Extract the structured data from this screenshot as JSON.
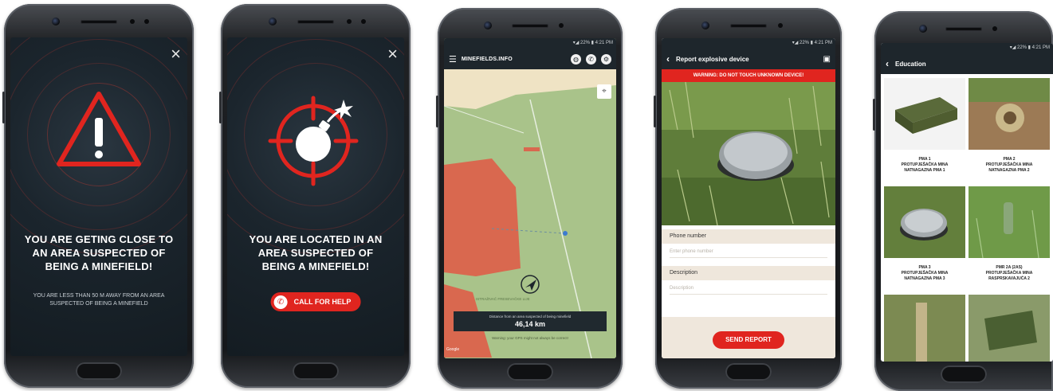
{
  "screens": {
    "approaching": {
      "close_icon": "×",
      "title_lines": [
        "YOU ARE GETING CLOSE TO",
        "AN AREA SUSPECTED OF",
        "BEING A MINEFIELD!"
      ],
      "sub_lines": [
        "YOU ARE LESS THAN 50 M AWAY FROM AN AREA",
        "SUSPECTED OF BEING A MINEFIELD"
      ]
    },
    "inside": {
      "close_icon": "×",
      "title_lines": [
        "YOU ARE LOCATED IN AN",
        "AREA SUSPECTED OF",
        "BEING A MINEFIELD!"
      ],
      "button_icon": "phone-icon",
      "button_label": "CALL FOR HELP"
    },
    "map": {
      "status": "▾◢ 22% ▮ 4:21 PM",
      "app_title": "MINEFIELDS.INFO",
      "place_label": "ISTRAŽIVAČ FRESEVAČKE LIJE",
      "distance_label": "Distance from an area suspected of being minefield",
      "distance_value": "46,14 km",
      "footer_note": "Warning: your GPS might not always be correct!",
      "map_credit": "Google"
    },
    "report": {
      "status": "▾◢ 22% ▮ 4:21 PM",
      "title": "Report explosive device",
      "warning": "WARNING: DO NOT TOUCH UNKNOWN DEVICE!",
      "phone_label": "Phone number",
      "phone_placeholder": "Enter phone number",
      "description_label": "Description",
      "description_placeholder": "Description",
      "send_label": "SEND REPORT"
    },
    "education": {
      "status": "▾◢ 22% ▮ 4:21 PM",
      "title": "Education",
      "tiles": [
        {
          "line1": "PMA 1",
          "line2": "PROTUPJEŠAČKA MINA",
          "line3": "NATNAGAZNA PMA 1"
        },
        {
          "line1": "PMA 2",
          "line2": "PROTUPJEŠAČKA MINA",
          "line3": "NATNAGAZNA PMA 2"
        },
        {
          "line1": "PMA 3",
          "line2": "PROTUPJEŠAČKA MINA",
          "line3": "NATNAGAZNA PMA 3"
        },
        {
          "line1": "PMR 2A (2AS)",
          "line2": "PROTUPJEŠAČKA MINA",
          "line3": "RASPRSKAVAJUĆA 2"
        }
      ]
    }
  },
  "colors": {
    "accent_red": "#e0251f",
    "header_dark": "#1e262c",
    "map_green": "#a9c38a",
    "map_red": "#d9684f"
  }
}
